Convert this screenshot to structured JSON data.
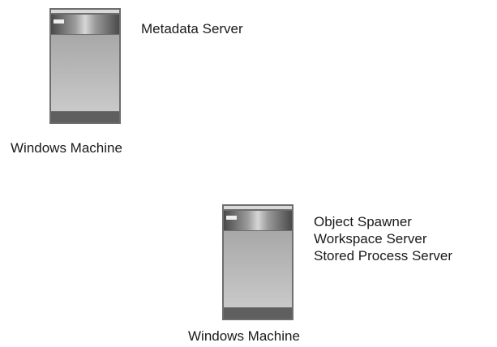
{
  "diagram": {
    "nodes": [
      {
        "machine_label": "Windows Machine",
        "icon": "server-tower-icon",
        "services": [
          "Metadata Server"
        ]
      },
      {
        "machine_label": "Windows Machine",
        "icon": "server-tower-icon",
        "services": [
          "Object Spawner",
          "Workspace Server",
          "Stored Process Server"
        ]
      }
    ]
  }
}
